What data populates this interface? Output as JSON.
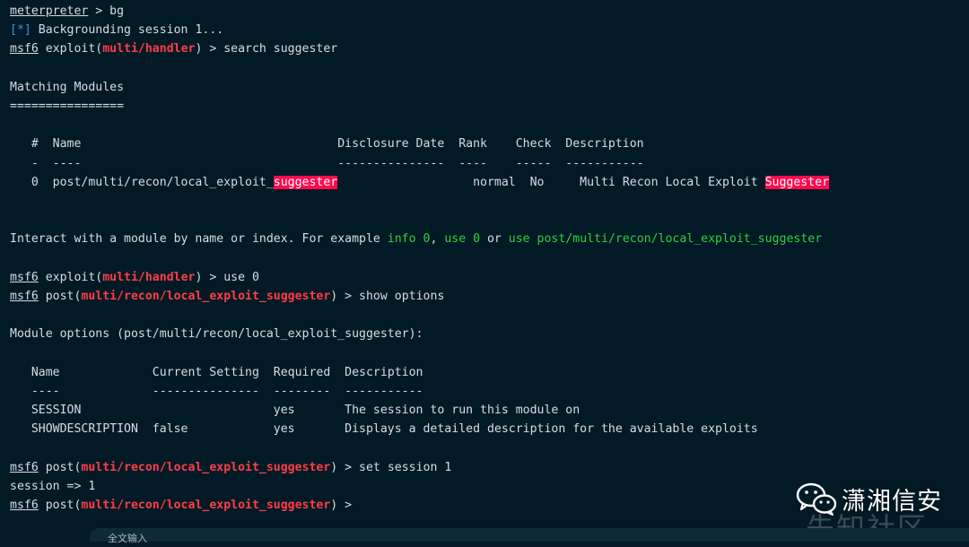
{
  "colors": {
    "background": "#011a26",
    "text": "#d8dde0",
    "module_red": "#ff3d46",
    "status_blue": "#4c8fe8",
    "command_green": "#2fd23a",
    "highlight": "#ff0a4e"
  },
  "lines": {
    "l1": {
      "prompt": "meterpreter",
      "rest": " > bg"
    },
    "l2": {
      "tag": "[*]",
      "text": " Backgrounding session 1..."
    },
    "l3": {
      "prompt": "msf6",
      "pre": " exploit(",
      "module": "multi/handler",
      "post": ") > search suggester"
    },
    "l5": "Matching Modules",
    "l6": "================",
    "search_header": "   #  Name                                    Disclosure Date  Rank    Check  Description",
    "search_sep": "   -  ----                                    ---------------  ----    -----  -----------",
    "search_row": {
      "idx_name_pre": "   0  post/multi/recon/local_exploit_",
      "name_hl": "suggester",
      "mid": "                   normal  No     Multi Recon Local Exploit ",
      "desc_hl": "Suggester"
    },
    "interact": {
      "pre": "Interact with a module by name or index. For example ",
      "c1": "info 0",
      "sep1": ", ",
      "c2": "use 0",
      "sep2": " or ",
      "c3": "use post/multi/recon/local_exploit_suggester"
    },
    "l_use": {
      "prompt": "msf6",
      "pre": " exploit(",
      "module": "multi/handler",
      "post": ") > use 0"
    },
    "l_show": {
      "prompt": "msf6",
      "pre": " post(",
      "module": "multi/recon/local_exploit_suggester",
      "post": ") > show options"
    },
    "module_options": "Module options (post/multi/recon/local_exploit_suggester):",
    "opt_header": "   Name             Current Setting  Required  Description",
    "opt_sep": "   ----             ---------------  --------  -----------",
    "opt_row1": "   SESSION                           yes       The session to run this module on",
    "opt_row2": "   SHOWDESCRIPTION  false            yes       Displays a detailed description for the available exploits",
    "l_set": {
      "prompt": "msf6",
      "pre": " post(",
      "module": "multi/recon/local_exploit_suggester",
      "post": ") > set session 1"
    },
    "l_session": "session => 1",
    "l_final": {
      "prompt": "msf6",
      "pre": " post(",
      "module": "multi/recon/local_exploit_suggester",
      "post": ") > "
    }
  },
  "watermark": {
    "icon": "wechat-icon",
    "title": "潇湘信安",
    "subtitle": "先知社区"
  },
  "bottom_bar": {
    "text": "全文输入"
  }
}
